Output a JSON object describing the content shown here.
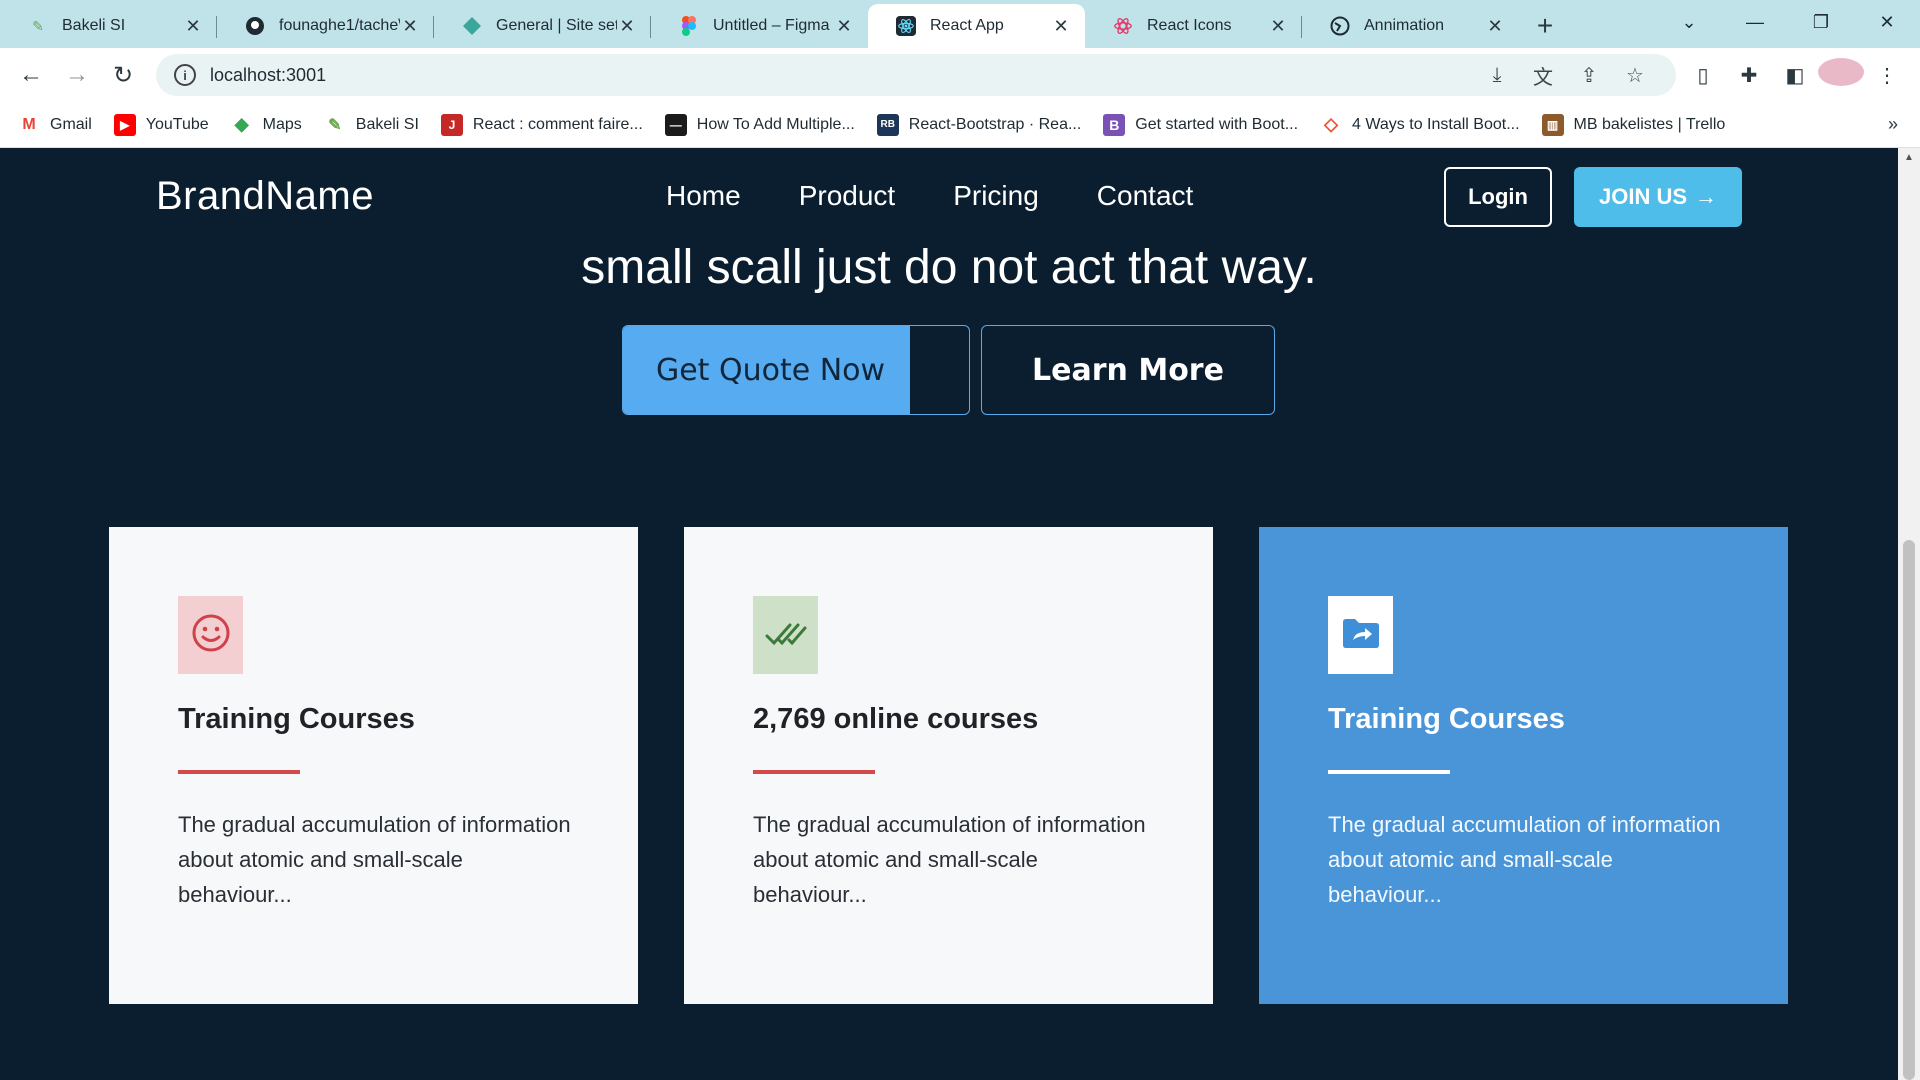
{
  "browser": {
    "tabs": [
      {
        "title": "Bakeli SI",
        "favicon": "bakeli-icon",
        "active": false
      },
      {
        "title": "founaghe1/tache\\",
        "favicon": "github-icon",
        "active": false
      },
      {
        "title": "General | Site sett",
        "favicon": "diamond-icon",
        "active": false
      },
      {
        "title": "Untitled – Figma",
        "favicon": "figma-icon",
        "active": false
      },
      {
        "title": "React App",
        "favicon": "react-icon",
        "active": true
      },
      {
        "title": "React Icons",
        "favicon": "react-icons-icon",
        "active": false
      },
      {
        "title": "Annimation",
        "favicon": "globe-icon",
        "active": false
      }
    ],
    "url": "localhost:3001",
    "bookmarks": [
      {
        "label": "Gmail",
        "icon": "gmail-icon",
        "color": "#ea4335",
        "glyph": "M"
      },
      {
        "label": "YouTube",
        "icon": "youtube-icon",
        "color": "#ff0000",
        "glyph": "▶"
      },
      {
        "label": "Maps",
        "icon": "maps-icon",
        "color": "#34a853",
        "glyph": "◆"
      },
      {
        "label": "Bakeli SI",
        "icon": "bakeli-icon",
        "color": "#6aa84f",
        "glyph": "✎"
      },
      {
        "label": "React : comment faire...",
        "icon": "j-icon",
        "color": "#c62828",
        "glyph": "J"
      },
      {
        "label": "How To Add Multiple...",
        "icon": "dev-icon",
        "color": "#1b1b1b",
        "glyph": "—"
      },
      {
        "label": "React-Bootstrap · Rea...",
        "icon": "react-bootstrap-icon",
        "color": "#1d3557",
        "glyph": "RB"
      },
      {
        "label": "Get started with Boot...",
        "icon": "bootstrap-icon",
        "color": "#7952b3",
        "glyph": "B"
      },
      {
        "label": "4 Ways to Install Boot...",
        "icon": "git-icon",
        "color": "#f05033",
        "glyph": "◇"
      },
      {
        "label": "MB bakelistes | Trello",
        "icon": "trello-icon",
        "color": "#8d5a2b",
        "glyph": "▥"
      }
    ]
  },
  "navbar": {
    "brand": "BrandName",
    "links": [
      "Home",
      "Product",
      "Pricing",
      "Contact"
    ],
    "login_label": "Login",
    "join_label": "JOIN US",
    "join_arrow": "→"
  },
  "hero": {
    "line": "small scall just do not act that way.",
    "quote_button": "Get Quote Now",
    "quote_button_fill_percent": 83,
    "learn_button": "Learn More"
  },
  "cards": [
    {
      "icon": "smile-icon",
      "icon_bg": "#f3cfd1",
      "title": "Training Courses",
      "text": "The gradual accumulation of information about atomic and small-scale behaviour...",
      "highlight": false
    },
    {
      "icon": "double-check-icon",
      "icon_bg": "#cfe0c9",
      "title": "2,769 online courses",
      "text": "The gradual accumulation of information about atomic and small-scale behaviour...",
      "highlight": false
    },
    {
      "icon": "folder-share-icon",
      "icon_bg": "#ffffff",
      "title": "Training Courses",
      "text": "The gradual accumulation of information about atomic and small-scale behaviour...",
      "highlight": true
    }
  ],
  "colors": {
    "page_bg": "#0b1e30",
    "accent_blue": "#57abf0",
    "join_blue": "#4fbde9",
    "card_blue": "#4a95d8",
    "rule_red": "#d24a4a"
  }
}
